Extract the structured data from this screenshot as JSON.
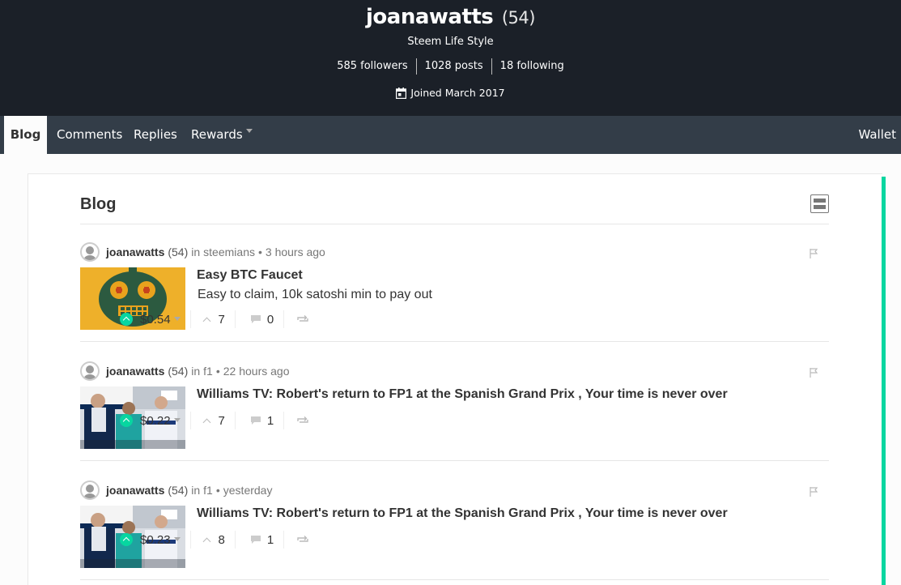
{
  "profile": {
    "name": "joanawatts",
    "reputation": "(54)",
    "about": "Steem Life Style",
    "followers": "585 followers",
    "posts": "1028 posts",
    "following": "18 following",
    "joined": "Joined March 2017"
  },
  "nav": {
    "tabs": [
      "Blog",
      "Comments",
      "Replies",
      "Rewards"
    ],
    "wallet": "Wallet"
  },
  "blog": {
    "heading": "Blog",
    "posts": [
      {
        "author": "joanawatts",
        "rep": "(54)",
        "in": "in",
        "community": "steemians",
        "time": "3 hours ago",
        "title": "Easy BTC Faucet",
        "desc": "Easy to claim, 10k satoshi min to pay out",
        "payout": "$0.54",
        "votes": "7",
        "comments": "0"
      },
      {
        "author": "joanawatts",
        "rep": "(54)",
        "in": "in",
        "community": "f1",
        "time": "22 hours ago",
        "title": "Williams TV: Robert's return to FP1 at the Spanish Grand Prix , Your time is never over",
        "desc": "",
        "payout": "$0.22",
        "votes": "7",
        "comments": "1"
      },
      {
        "author": "joanawatts",
        "rep": "(54)",
        "in": "in",
        "community": "f1",
        "time": "yesterday",
        "title": "Williams TV: Robert's return to FP1 at the Spanish Grand Prix , Your time is never over",
        "desc": "",
        "payout": "$0.23",
        "votes": "8",
        "comments": "1"
      }
    ]
  },
  "colors": {
    "header_bg": "#1b2028",
    "nav_bg": "#333d48",
    "accent": "#07d6a0"
  }
}
